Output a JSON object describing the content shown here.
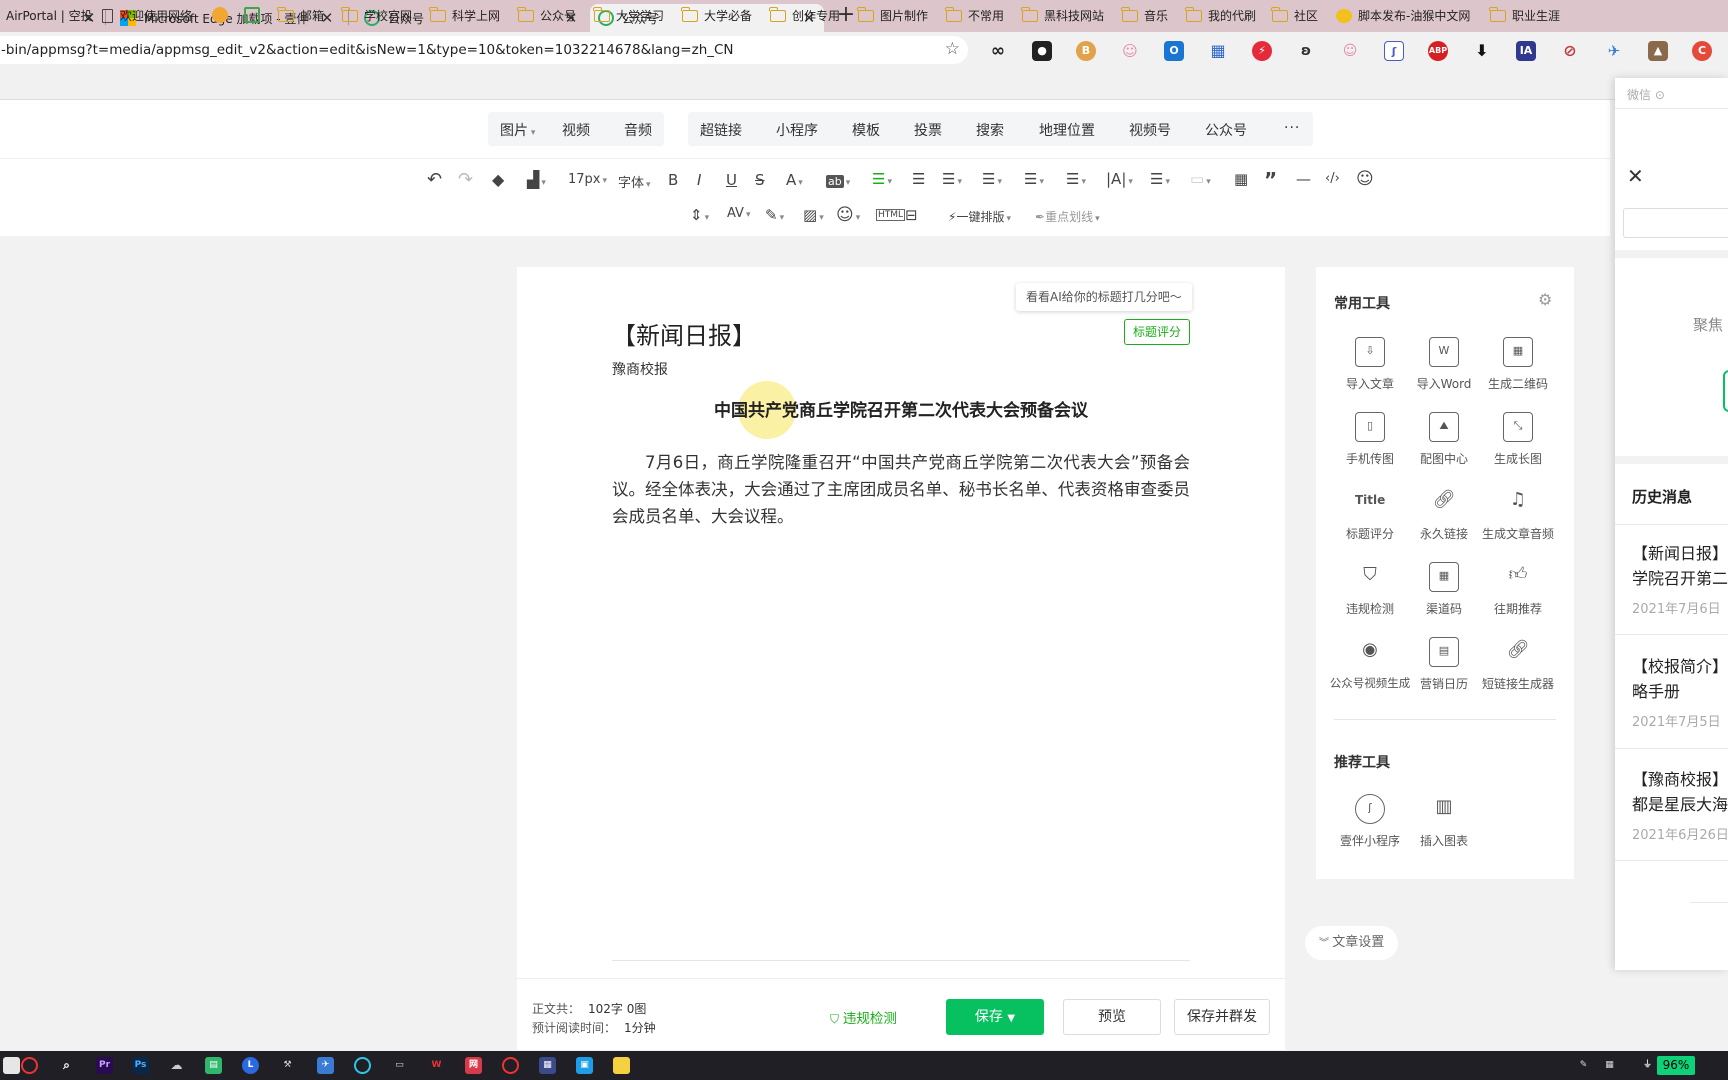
{
  "browser": {
    "tabs": [
      {
        "label": "",
        "icon": "blank-tab"
      },
      {
        "label": "Microsoft Edge 加载项 - 壹伴",
        "icon": "microsoft-logo"
      },
      {
        "label": "公众号",
        "icon": "wechat-mp-logo"
      },
      {
        "label": "公众号",
        "icon": "wechat-mp-logo",
        "active": true
      }
    ],
    "url": "-bin/appmsg?t=media/appmsg_edit_v2&action=edit&isNew=1&type=10&token=1032214678&lang=zh_CN",
    "extensions": [
      "infinity",
      "ghost",
      "coin",
      "cat",
      "outlook",
      "apps",
      "flash",
      "cat2",
      "cat3",
      "tool",
      "ABP",
      "download",
      "IA",
      "block",
      "bird",
      "avatar",
      "C"
    ],
    "bookmarks": [
      {
        "label": "AirPortal | 空投",
        "type": "link"
      },
      {
        "label": "欢迎使用网络",
        "type": "page"
      },
      {
        "label": "",
        "type": "app"
      },
      {
        "label": "",
        "type": "app"
      },
      {
        "label": "邮箱",
        "type": "folder"
      },
      {
        "label": "学校官网",
        "type": "folder"
      },
      {
        "label": "科学上网",
        "type": "folder"
      },
      {
        "label": "公众号",
        "type": "folder"
      },
      {
        "label": "大学学习",
        "type": "folder"
      },
      {
        "label": "大学必备",
        "type": "folder"
      },
      {
        "label": "创作专用",
        "type": "folder"
      },
      {
        "label": "图片制作",
        "type": "folder"
      },
      {
        "label": "不常用",
        "type": "folder"
      },
      {
        "label": "黑科技网站",
        "type": "folder"
      },
      {
        "label": "音乐",
        "type": "folder"
      },
      {
        "label": "我的代刷",
        "type": "folder"
      },
      {
        "label": "社区",
        "type": "folder"
      },
      {
        "label": "脚本发布-油猴中文网",
        "type": "link"
      },
      {
        "label": "职业生涯",
        "type": "folder"
      }
    ]
  },
  "editor": {
    "insert_left": [
      "图片",
      "视频",
      "音频"
    ],
    "insert_right": [
      "超链接",
      "小程序",
      "模板",
      "投票",
      "搜索",
      "地理位置",
      "视频号",
      "公众号",
      "···"
    ],
    "font_size": "17px",
    "font_family": "字体",
    "one_key_layout": "一键排版",
    "key_underline": "重点划线"
  },
  "article": {
    "ai_tip": "看看AI给你的标题打几分吧～",
    "title_score_btn": "标题评分",
    "title": "【新闻日报】",
    "author": "豫商校报",
    "heading": "中国共产党商丘学院召开第二次代表大会预备会议",
    "body": "7月6日，商丘学院隆重召开“中国共产党商丘学院第二次代表大会”预备会议。经全体表决，大会通过了主席团成员名单、秘书长名单、代表资格审查委员会成员名单、大会议程。"
  },
  "footer": {
    "word_label": "正文共：",
    "word_count": "102字 0图",
    "read_label": "预计阅读时间：",
    "read_time": "1分钟",
    "violation": "违规检测",
    "save": "保存",
    "preview": "预览",
    "save_send": "保存并群发"
  },
  "tools": {
    "common_title": "常用工具",
    "common": [
      {
        "label": "导入文章",
        "icon": "import-icon"
      },
      {
        "label": "导入Word",
        "icon": "word-icon"
      },
      {
        "label": "生成二维码",
        "icon": "qrcode-icon"
      },
      {
        "label": "手机传图",
        "icon": "phone-icon"
      },
      {
        "label": "配图中心",
        "icon": "image-icon"
      },
      {
        "label": "生成长图",
        "icon": "long-image-icon"
      },
      {
        "label": "标题评分",
        "icon": "title-icon"
      },
      {
        "label": "永久链接",
        "icon": "link-icon"
      },
      {
        "label": "生成文章音频",
        "icon": "audio-icon"
      },
      {
        "label": "违规检测",
        "icon": "shield-icon"
      },
      {
        "label": "渠道码",
        "icon": "channel-qrcode-icon"
      },
      {
        "label": "往期推荐",
        "icon": "thumbs-up-icon"
      },
      {
        "label": "公众号视频生成",
        "icon": "video-icon"
      },
      {
        "label": "营销日历",
        "icon": "calendar-icon"
      },
      {
        "label": "短链接生成器",
        "icon": "short-link-icon"
      }
    ],
    "recommend_title": "推荐工具",
    "recommend": [
      {
        "label": "壹伴小程序",
        "icon": "mini-program-icon"
      },
      {
        "label": "插入图表",
        "icon": "chart-icon"
      }
    ],
    "settings": "文章设置"
  },
  "overlay": {
    "header": "微信",
    "focus_text": "聚焦",
    "history_title": "历史消息",
    "items": [
      {
        "title1": "【新闻日报】",
        "title2": "学院召开第二",
        "date": "2021年7月6日"
      },
      {
        "title1": "【校报简介】",
        "title2": "略手册",
        "date": "2021年7月5日"
      },
      {
        "title1": "【豫商校报】",
        "title2": "都是星辰大海",
        "date": "2021年6月26日"
      }
    ]
  },
  "taskbar": {
    "battery": "96%"
  }
}
